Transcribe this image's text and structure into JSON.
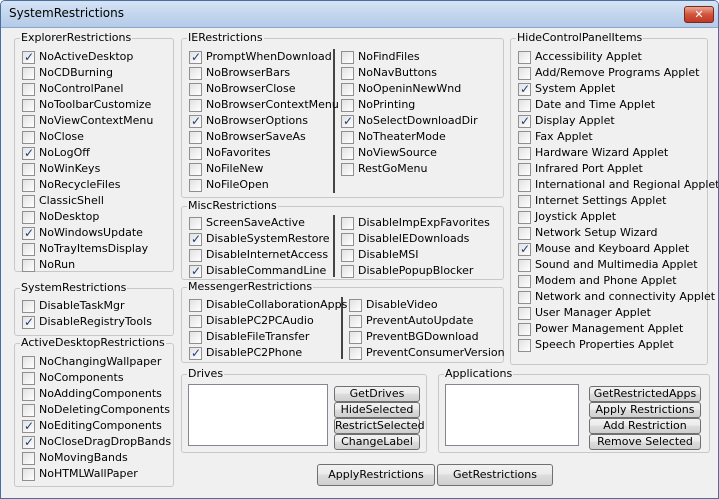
{
  "title": "SystemRestrictions",
  "close_label": "✕",
  "explorer": {
    "label": "ExplorerRestrictions",
    "items": [
      {
        "label": "NoActiveDesktop",
        "checked": true
      },
      {
        "label": "NoCDBurning",
        "checked": false
      },
      {
        "label": "NoControlPanel",
        "checked": false
      },
      {
        "label": "NoToolbarCustomize",
        "checked": false
      },
      {
        "label": "NoViewContextMenu",
        "checked": false
      },
      {
        "label": "NoClose",
        "checked": false
      },
      {
        "label": "NoLogOff",
        "checked": true
      },
      {
        "label": "NoWinKeys",
        "checked": false
      },
      {
        "label": "NoRecycleFiles",
        "checked": false
      },
      {
        "label": "ClassicShell",
        "checked": false
      },
      {
        "label": "NoDesktop",
        "checked": false
      },
      {
        "label": "NoWindowsUpdate",
        "checked": true
      },
      {
        "label": "NoTrayItemsDisplay",
        "checked": false
      },
      {
        "label": "NoRun",
        "checked": false
      }
    ]
  },
  "system": {
    "label": "SystemRestrictions",
    "items": [
      {
        "label": "DisableTaskMgr",
        "checked": false
      },
      {
        "label": "DisableRegistryTools",
        "checked": true
      }
    ]
  },
  "active_desktop": {
    "label": "ActiveDesktopRestrictions",
    "items": [
      {
        "label": "NoChangingWallpaper",
        "checked": false
      },
      {
        "label": "NoComponents",
        "checked": false
      },
      {
        "label": "NoAddingComponents",
        "checked": false
      },
      {
        "label": "NoDeletingComponents",
        "checked": false
      },
      {
        "label": "NoEditingComponents",
        "checked": true
      },
      {
        "label": "NoCloseDragDropBands",
        "checked": true
      },
      {
        "label": "NoMovingBands",
        "checked": false
      },
      {
        "label": "NoHTMLWallPaper",
        "checked": false
      }
    ]
  },
  "ie": {
    "label": "IERestrictions",
    "col1": [
      {
        "label": "PromptWhenDownload",
        "checked": true
      },
      {
        "label": "NoBrowserBars",
        "checked": false
      },
      {
        "label": "NoBrowserClose",
        "checked": false
      },
      {
        "label": "NoBrowserContextMenu",
        "checked": false
      },
      {
        "label": "NoBrowserOptions",
        "checked": true
      },
      {
        "label": "NoBrowserSaveAs",
        "checked": false
      },
      {
        "label": "NoFavorites",
        "checked": false
      },
      {
        "label": "NoFileNew",
        "checked": false
      },
      {
        "label": "NoFileOpen",
        "checked": false
      }
    ],
    "col2": [
      {
        "label": "NoFindFiles",
        "checked": false
      },
      {
        "label": "NoNavButtons",
        "checked": false
      },
      {
        "label": "NoOpeninNewWnd",
        "checked": false
      },
      {
        "label": "NoPrinting",
        "checked": false
      },
      {
        "label": "NoSelectDownloadDir",
        "checked": true
      },
      {
        "label": "NoTheaterMode",
        "checked": false
      },
      {
        "label": "NoViewSource",
        "checked": false
      },
      {
        "label": "RestGoMenu",
        "checked": false
      }
    ]
  },
  "misc": {
    "label": "MiscRestrictions",
    "col1": [
      {
        "label": "ScreenSaveActive",
        "checked": false
      },
      {
        "label": "DisableSystemRestore",
        "checked": true
      },
      {
        "label": "DisableInternetAccess",
        "checked": false
      },
      {
        "label": "DisableCommandLine",
        "checked": true
      }
    ],
    "col2": [
      {
        "label": "DisableImpExpFavorites",
        "checked": false
      },
      {
        "label": "DisableIEDownloads",
        "checked": false
      },
      {
        "label": "DisableMSI",
        "checked": false
      },
      {
        "label": "DisablePopupBlocker",
        "checked": false
      }
    ]
  },
  "messenger": {
    "label": "MessengerRestrictions",
    "col1": [
      {
        "label": "DisableCollaborationApps",
        "checked": false
      },
      {
        "label": "DisablePC2PCAudio",
        "checked": false
      },
      {
        "label": "DisableFileTransfer",
        "checked": false
      },
      {
        "label": "DisablePC2Phone",
        "checked": true
      }
    ],
    "col2": [
      {
        "label": "DisableVideo",
        "checked": false
      },
      {
        "label": "PreventAutoUpdate",
        "checked": false
      },
      {
        "label": "PreventBGDownload",
        "checked": false
      },
      {
        "label": "PreventConsumerVersion",
        "checked": false
      }
    ]
  },
  "control_panel": {
    "label": "HideControlPanelItems",
    "items": [
      {
        "label": "Accessibility Applet",
        "checked": false
      },
      {
        "label": "Add/Remove Programs Applet",
        "checked": false
      },
      {
        "label": "System Applet",
        "checked": true
      },
      {
        "label": "Date and Time Applet",
        "checked": false
      },
      {
        "label": "Display Applet",
        "checked": true
      },
      {
        "label": "Fax Applet",
        "checked": false
      },
      {
        "label": "Hardware Wizard Applet",
        "checked": false
      },
      {
        "label": "Infrared Port Applet",
        "checked": false
      },
      {
        "label": "International and Regional Applet",
        "checked": false
      },
      {
        "label": "Internet Settings Applet",
        "checked": false
      },
      {
        "label": "Joystick Applet",
        "checked": false
      },
      {
        "label": "Network Setup Wizard",
        "checked": false
      },
      {
        "label": "Mouse and Keyboard Applet",
        "checked": true
      },
      {
        "label": "Sound and Multimedia Applet",
        "checked": false
      },
      {
        "label": "Modem and Phone Applet",
        "checked": false
      },
      {
        "label": "Network and connectivity Applet",
        "checked": false
      },
      {
        "label": "User Manager Applet",
        "checked": false
      },
      {
        "label": "Power Management Applet",
        "checked": false
      },
      {
        "label": "Speech Properties Applet",
        "checked": false
      }
    ]
  },
  "drives": {
    "label": "Drives",
    "buttons": [
      "GetDrives",
      "HideSelected",
      "RestrictSelected",
      "ChangeLabel"
    ]
  },
  "applications": {
    "label": "Applications",
    "buttons": [
      "GetRestrictedApps",
      "Apply Restrictions",
      "Add Restriction",
      "Remove Selected"
    ]
  },
  "bottom_buttons": {
    "apply": "ApplyRestrictions",
    "get": "GetRestrictions"
  }
}
